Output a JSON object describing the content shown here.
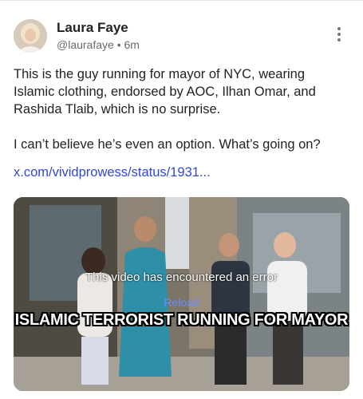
{
  "post": {
    "author_name": "Laura Faye",
    "handle": "@laurafaye",
    "separator": "•",
    "time_ago": "6m",
    "paragraphs": [
      "This is the guy running for mayor of NYC, wearing Islamic clothing, endorsed by AOC, Ilhan Omar, and Rashida Tlaib, which is no surprise.",
      "I can’t believe he’s even an option. What’s going on?"
    ],
    "link_text": "x.com/vividprowess/status/1931...",
    "more_icon": "vertical-ellipsis-icon"
  },
  "video": {
    "error_text": "This video has encountered an error",
    "reload_label": "Reload",
    "caption": "ISLAMIC TERRORIST RUNNING FOR MAYOR"
  }
}
